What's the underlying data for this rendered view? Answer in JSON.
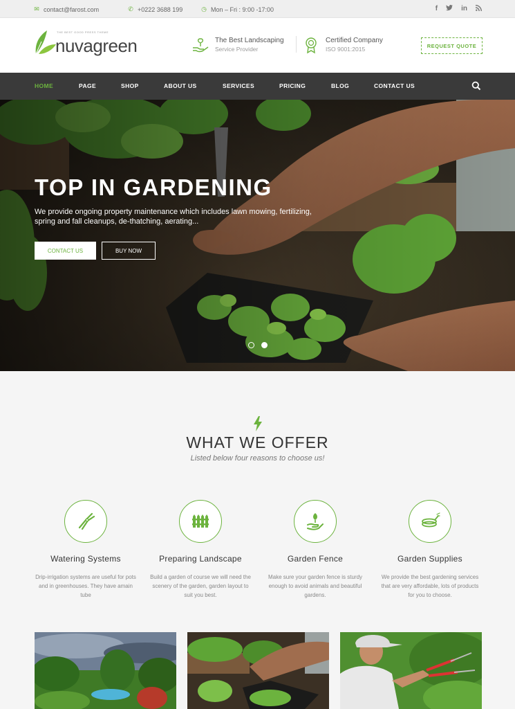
{
  "topbar": {
    "email": "contact@farost.com",
    "phone": "+0222 3688 199",
    "hours": "Mon – Fri : 9:00 -17:00",
    "social": [
      "f",
      "t",
      "in",
      "rss"
    ]
  },
  "header": {
    "logo_tagline": "THE BEST GOOD PRESS THEME",
    "logo_text": "nuvagreen",
    "info1_title": "The Best Landscaping",
    "info1_sub": "Service Provider",
    "info2_title": "Certified Company",
    "info2_sub": "ISO 9001:2015",
    "quote_label": "REQUEST QUOTE"
  },
  "nav": {
    "items": [
      "HOME",
      "PAGE",
      "SHOP",
      "ABOUT US",
      "SERVICES",
      "PRICING",
      "BLOG",
      "CONTACT US"
    ],
    "active": "HOME"
  },
  "hero": {
    "title": "TOP IN GARDENING",
    "text": "We provide ongoing property maintenance which includes lawn mowing, fertilizing, spring and fall cleanups, de-thatching, aerating...",
    "btn_contact": "CONTACT US",
    "btn_buy": "BUY NOW"
  },
  "offer": {
    "title": "WHAT WE OFFER",
    "subtitle": "Listed below four reasons to choose us!",
    "features": [
      {
        "title": "Watering Systems",
        "desc": "Drip-irrigation systems are useful for pots and in greenhouses. They have amain tube",
        "icon": "shears-icon"
      },
      {
        "title": "Preparing Landscape",
        "desc": "Build a garden of course we will need the scenery of the garden, garden layout to suit you best.",
        "icon": "fence-icon"
      },
      {
        "title": "Garden Fence",
        "desc": "Make sure your garden fence is sturdy enough to avoid animals and beautiful gardens.",
        "icon": "plant-hand-icon"
      },
      {
        "title": "Garden Supplies",
        "desc": "We provide the best gardening services that are very affordable, lots of products for you to choose.",
        "icon": "hose-icon"
      }
    ]
  },
  "colors": {
    "accent": "#6cb33e",
    "nav_bg": "#3a3a3a",
    "topbar_bg": "#efefef"
  }
}
